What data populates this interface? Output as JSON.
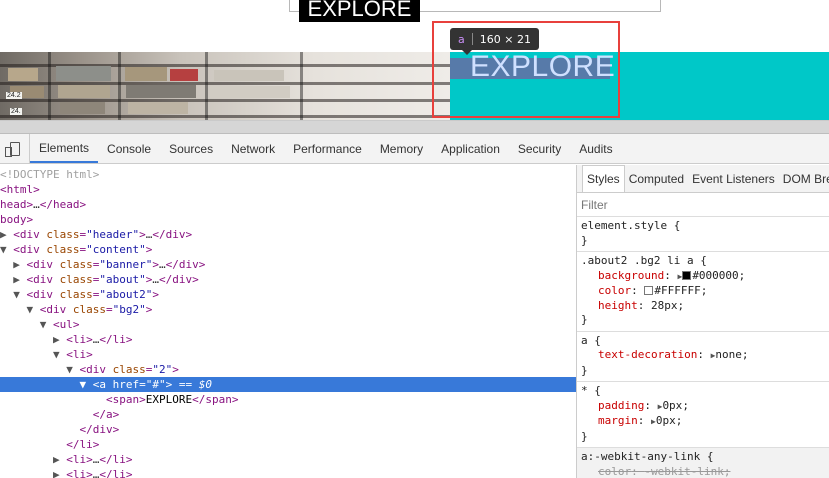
{
  "page": {
    "top_button_label": "EXPLORE",
    "link_text": "EXPLORE",
    "shelf_tags": [
      "24.2",
      "24."
    ],
    "colors": {
      "teal_panel": "#00c8c8",
      "link_bg": "#5c76a8",
      "highlight_border": "#e8403c"
    }
  },
  "tooltip": {
    "tag": "a",
    "size": "160 × 21"
  },
  "devtools": {
    "tabs": [
      "Elements",
      "Console",
      "Sources",
      "Network",
      "Performance",
      "Memory",
      "Application",
      "Security",
      "Audits"
    ],
    "dom": {
      "doctype": "OCTYPE html>",
      "html_open": "tml>",
      "head_open": "head>",
      "head_close": "</head>",
      "body_open": "body>",
      "div": "div",
      "class": "class",
      "header": "\"header\"",
      "content": "\"content\"",
      "banner": "\"banner\"",
      "about": "\"about\"",
      "about2": "\"about2\"",
      "bg2": "\"bg2\"",
      "c2": "\"2\"",
      "ul": "<ul>",
      "li_open": "<li>",
      "li_collapsed_end": "</li>",
      "ellipsis": "…",
      "div_close": "</div>",
      "a": "a",
      "href": "href",
      "href_val": "\"#\"",
      "eq0": "== $0",
      "span_open": "<span>",
      "span_text": "EXPLORE",
      "span_close": "</span>",
      "a_close": "</a>",
      "li_close": "</li>"
    },
    "subtabs": [
      "Styles",
      "Computed",
      "Event Listeners",
      "DOM Bre"
    ],
    "filter_placeholder": "Filter",
    "rules": [
      {
        "selector": "element.style {",
        "props": []
      },
      {
        "selector": ".about2 .bg2 li a {",
        "props": [
          {
            "name": "background",
            "value": "#000000",
            "swatch": "#000000"
          },
          {
            "name": "color",
            "value": "#FFFFFF",
            "swatch": "#FFFFFF"
          },
          {
            "name": "height",
            "value": "28px"
          }
        ]
      },
      {
        "selector": "a {",
        "props": [
          {
            "name": "text-decoration",
            "value": "none"
          }
        ]
      },
      {
        "selector": "* {",
        "props": [
          {
            "name": "padding",
            "value": "0px"
          },
          {
            "name": "margin",
            "value": "0px"
          }
        ]
      },
      {
        "selector": "a:-webkit-any-link {",
        "props": [
          {
            "name": "color",
            "value": "-webkit-link;"
          }
        ]
      }
    ],
    "close_brace": "}"
  }
}
